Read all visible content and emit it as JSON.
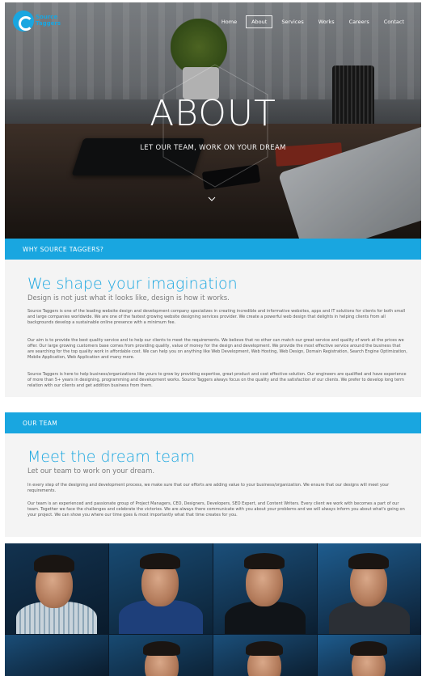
{
  "brand": {
    "line1": "Source",
    "line2": "Taggers"
  },
  "nav": {
    "items": [
      {
        "label": "Home",
        "active": false
      },
      {
        "label": "About",
        "active": true
      },
      {
        "label": "Services",
        "active": false
      },
      {
        "label": "Works",
        "active": false
      },
      {
        "label": "Careers",
        "active": false
      },
      {
        "label": "Contact",
        "active": false
      }
    ]
  },
  "hero": {
    "title": "ABOUT",
    "subtitle": "LET OUR TEAM, WORK ON YOUR DREAM"
  },
  "why": {
    "band": "WHY SOURCE TAGGERS?",
    "heading": "We shape your imagination",
    "tagline": "Design is not just what it looks like, design is how it works.",
    "p1": "Source Taggers is one of the leading website design and development company specializes in creating incredible and informative websites, apps and IT solutions for clients for both small and large companies worldwide. We are one of the fastest growing website designing services provider. We create a powerful web design that delights in helping clients from all backgrounds develop a sustainable online presence with a minimum fee.",
    "p2": "Our aim is to provide the best quality service and to help our clients to meet the requirements. We believe that no other can match our great service and quality of work at the prices we offer. Our large growing customers base comes from providing quality, value of money for the design and development. We provide the most effective service around the business that are searching for the top quality work in affordable cost. We can help you on anything like Web Development, Web Hosting, Web Design, Domain Registration, Search Engine Optimization, Mobile Application, Web Application and many more.",
    "p3": "Source Taggers is here to help business/organizations like yours to grow by providing expertise, great product and cost effective solution. Our engineers are qualified and have experience of more than 5+ years in designing, programming and development works. Source Taggers always focus on the quality and the satisfaction of our clients. We prefer to develop long term relation with our clients and get addition business from them."
  },
  "team": {
    "band": "OUR TEAM",
    "heading": "Meet the dream team",
    "tagline": "Let our team to work on your dream.",
    "p1": "In every step of the designing and development process, we make sure that our efforts are adding value to your business/organization. We ensure that our designs will meet your requirements.",
    "p2": "Our team is an experienced and passionate group of Project Managers, CEO, Designers, Developers, SEO Expert, and Content Writers. Every client we work with becomes a part of our team. Together we face the challenges and celebrate the victories. We are always there communicate with you about your problems and we will always inform you about what's going on your project. We can show you where our time goes & most importantly what that time creates for you."
  },
  "colors": {
    "accent": "#19a6e0",
    "panel": "#f4f4f4"
  }
}
